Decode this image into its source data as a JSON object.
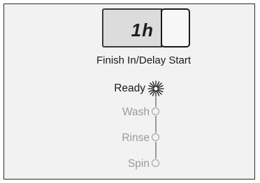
{
  "delay_display": {
    "readout": "1h",
    "label": "Finish In/Delay Start"
  },
  "status_indicators": [
    {
      "label": "Ready",
      "state": "lit"
    },
    {
      "label": "Wash",
      "state": "off"
    },
    {
      "label": "Rinse",
      "state": "off"
    },
    {
      "label": "Spin",
      "state": "off"
    }
  ],
  "colors": {
    "active_text": "#1a1a1a",
    "inactive_text": "#9a9a9a",
    "panel_background": "#f2f2f2",
    "display_background": "#dcdcdc"
  }
}
